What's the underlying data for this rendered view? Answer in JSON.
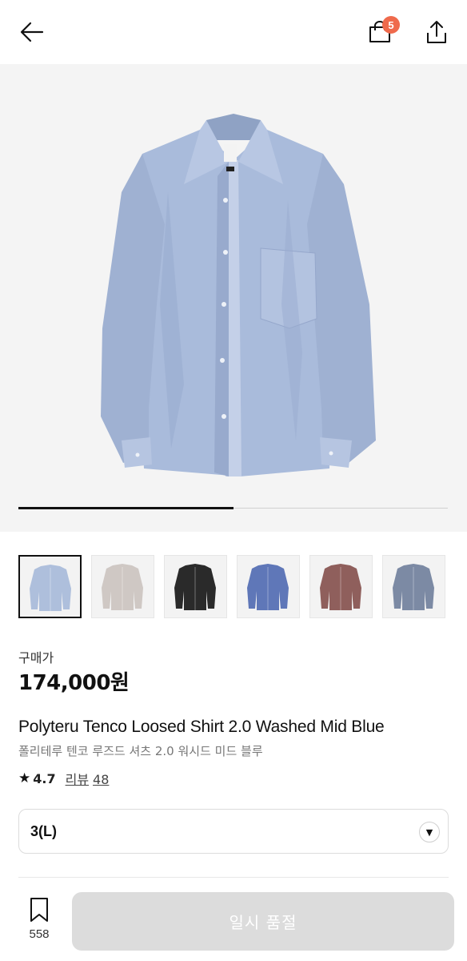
{
  "header": {
    "back_icon": "arrow-left-icon",
    "cart_icon": "shopping-bag-icon",
    "cart_count": "5",
    "share_icon": "share-upload-icon"
  },
  "gallery": {
    "current_slide_fraction": 0.5,
    "thumbnails": [
      {
        "color": "light-blue",
        "hex": "#aebfdc",
        "selected": true
      },
      {
        "color": "grey-beige",
        "hex": "#cfc8c4",
        "selected": false
      },
      {
        "color": "black",
        "hex": "#2a2a2a",
        "selected": false
      },
      {
        "color": "blue",
        "hex": "#5f77b8",
        "selected": false
      },
      {
        "color": "brown",
        "hex": "#8f5f5c",
        "selected": false
      },
      {
        "color": "slate-blue",
        "hex": "#7c8aa4",
        "selected": false
      }
    ]
  },
  "product": {
    "price_label": "구매가",
    "price": "174,000원",
    "name_en": "Polyteru Tenco Loosed Shirt 2.0 Washed Mid Blue",
    "name_ko": "폴리테루 텐코 루즈드 셔츠 2.0 워시드 미드 블루",
    "rating": "4.7",
    "review_label": "리뷰",
    "review_count": "48"
  },
  "size_select": {
    "value": "3(L)"
  },
  "bottom_bar": {
    "wish_count": "558",
    "soldout_label": "일시 품절"
  },
  "colors": {
    "badge": "#ef6a4c",
    "soldout_bg": "#dcdcdc"
  }
}
